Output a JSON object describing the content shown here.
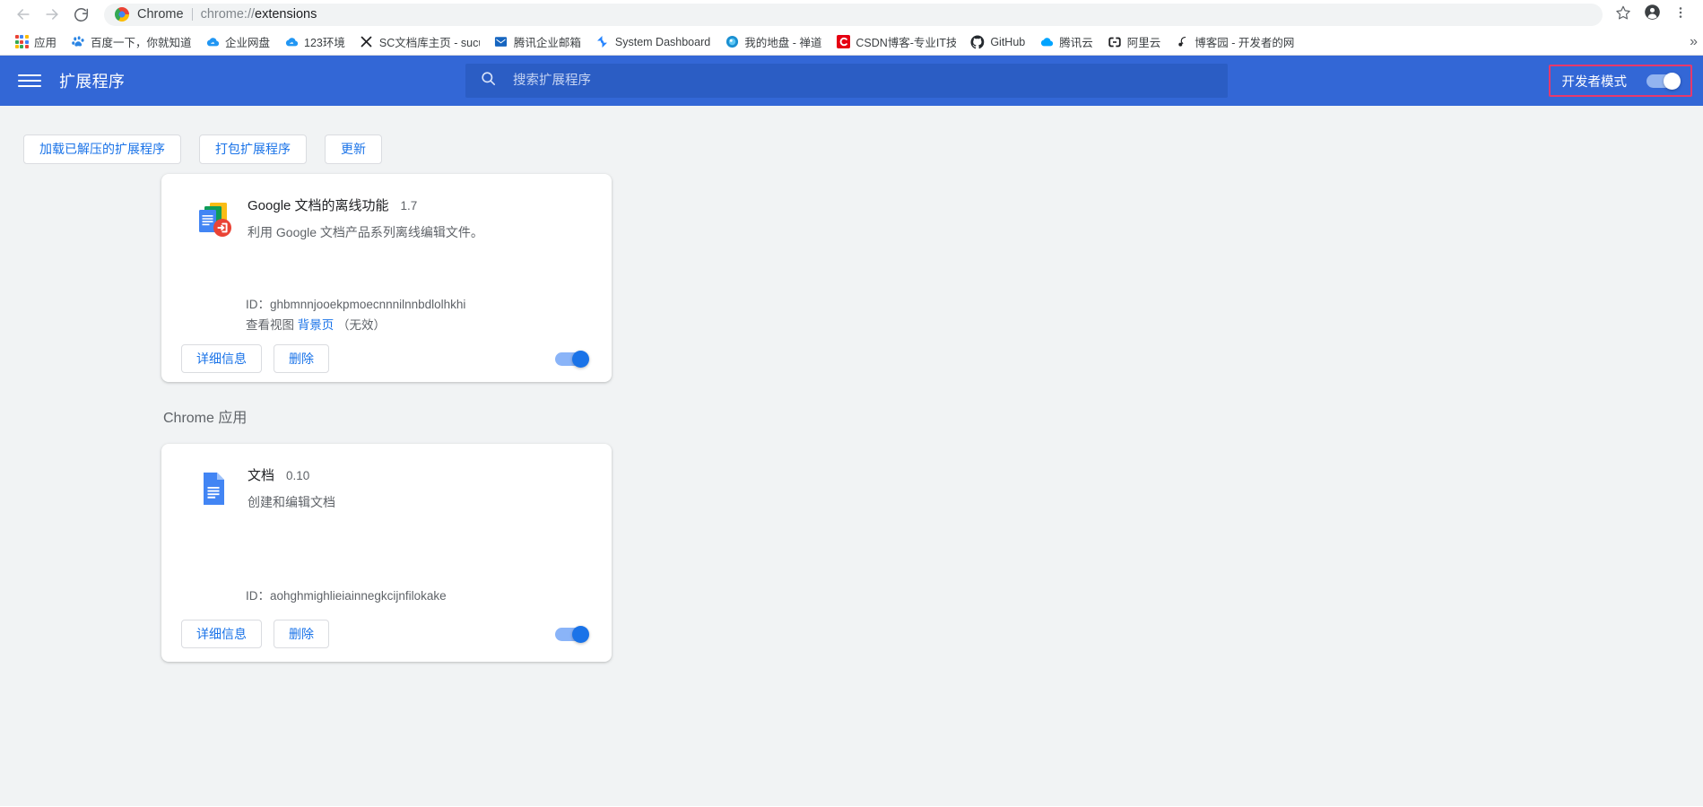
{
  "browser": {
    "nav": {
      "back": "back-arrow",
      "forward": "forward-arrow",
      "reload": "reload"
    },
    "omnibox": {
      "scheme_label": "Chrome",
      "url_host": "chrome://",
      "url_path": "extensions",
      "site_icon": "chrome-logo"
    },
    "toolbar_right": [
      {
        "name": "bookmark-star-icon",
        "label": "☆"
      },
      {
        "name": "profile-avatar-icon",
        "label": ""
      },
      {
        "name": "chrome-menu-icon",
        "label": "⋮"
      }
    ],
    "bookmarks": [
      {
        "label": "应用",
        "icon": "apps-grid-icon"
      },
      {
        "label": "百度一下，你就知道",
        "icon": "baidu-icon"
      },
      {
        "label": "企业网盘",
        "icon": "cloud-icon"
      },
      {
        "label": "123环境",
        "icon": "cloud-icon"
      },
      {
        "label": "SC文档库主页 - sucu",
        "icon": "x-icon"
      },
      {
        "label": "腾讯企业邮箱",
        "icon": "mail-icon"
      },
      {
        "label": "System Dashboard",
        "icon": "jira-icon"
      },
      {
        "label": "我的地盘 - 禅道",
        "icon": "zentao-icon"
      },
      {
        "label": "CSDN博客-专业IT技",
        "icon": "csdn-icon"
      },
      {
        "label": "GitHub",
        "icon": "github-icon"
      },
      {
        "label": "腾讯云",
        "icon": "tencent-cloud-icon"
      },
      {
        "label": "阿里云",
        "icon": "aliyun-icon"
      },
      {
        "label": "博客园 - 开发者的网",
        "icon": "cnblogs-icon"
      }
    ],
    "bookmarks_overflow": "»"
  },
  "extensions_page": {
    "header": {
      "title": "扩展程序",
      "menu_icon": "hamburger-menu-icon",
      "search": {
        "placeholder": "搜索扩展程序",
        "value": "",
        "icon": "search-icon"
      },
      "developer_mode": {
        "label": "开发者模式",
        "enabled": true,
        "highlight_color": "#e8396b"
      }
    },
    "toolbar": {
      "load_unpacked": "加载已解压的扩展程序",
      "pack_extension": "打包扩展程序",
      "update": "更新"
    },
    "labels": {
      "id_prefix": "ID：",
      "inspect_views": "查看视图",
      "details": "详细信息",
      "remove": "删除"
    },
    "extensions": [
      {
        "name": "Google 文档的离线功能",
        "version": "1.7",
        "description": "利用 Google 文档产品系列离线编辑文件。",
        "id": "ghbmnnjooekpmoecnnnilnnbdlolhkhi",
        "inspect_views_label": "查看视图",
        "view_link": "背景页",
        "view_note": "（无效）",
        "enabled": true,
        "icon": "google-docs-offline-icon"
      }
    ],
    "apps_section": {
      "title": "Chrome 应用",
      "apps": [
        {
          "name": "文档",
          "version": "0.10",
          "description": "创建和编辑文档",
          "id": "aohghmighlieiainnegkcijnfilokake",
          "enabled": true,
          "icon": "google-docs-icon"
        }
      ]
    }
  },
  "colors": {
    "header_blue": "#3367d6",
    "search_blue": "#2b5dc4",
    "accent_blue": "#1a73e8",
    "page_bg": "#f1f3f4",
    "toggle_track": "#8ab4f8",
    "highlight_red": "#e8396b"
  }
}
